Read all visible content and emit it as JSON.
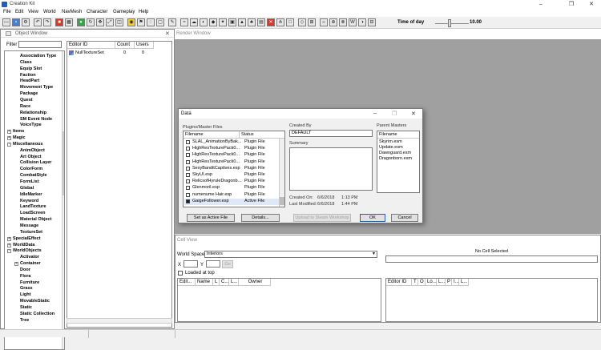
{
  "app": {
    "title": "Creation Kit"
  },
  "window_buttons": {
    "minimize": "–",
    "maximize": "❐",
    "close": "✕"
  },
  "menu": [
    "File",
    "Edit",
    "View",
    "World",
    "NavMesh",
    "Character",
    "Gameplay",
    "Help"
  ],
  "toolbar": {
    "time_of_day_label": "Time of day",
    "time_of_day_value": "10.00",
    "time_of_day_fraction": 0.42
  },
  "object_window": {
    "title": "Object Window",
    "filter_label": "Filter",
    "tree": [
      {
        "label": "Association Type",
        "indent": 1,
        "expander": ""
      },
      {
        "label": "Class",
        "indent": 1,
        "expander": ""
      },
      {
        "label": "Equip Slot",
        "indent": 1,
        "expander": ""
      },
      {
        "label": "Faction",
        "indent": 1,
        "expander": ""
      },
      {
        "label": "HeadPart",
        "indent": 1,
        "expander": ""
      },
      {
        "label": "Movement Type",
        "indent": 1,
        "expander": ""
      },
      {
        "label": "Package",
        "indent": 1,
        "expander": ""
      },
      {
        "label": "Quest",
        "indent": 1,
        "expander": ""
      },
      {
        "label": "Race",
        "indent": 1,
        "expander": ""
      },
      {
        "label": "Relationship",
        "indent": 1,
        "expander": ""
      },
      {
        "label": "SM Event Node",
        "indent": 1,
        "expander": ""
      },
      {
        "label": "VoiceType",
        "indent": 1,
        "expander": ""
      },
      {
        "label": "Items",
        "indent": 0,
        "expander": "+"
      },
      {
        "label": "Magic",
        "indent": 0,
        "expander": "+"
      },
      {
        "label": "Miscellaneous",
        "indent": 0,
        "expander": "-"
      },
      {
        "label": "AnimObject",
        "indent": 1,
        "expander": ""
      },
      {
        "label": "Art Object",
        "indent": 1,
        "expander": ""
      },
      {
        "label": "Collision Layer",
        "indent": 1,
        "expander": ""
      },
      {
        "label": "ColorForm",
        "indent": 1,
        "expander": ""
      },
      {
        "label": "CombatStyle",
        "indent": 1,
        "expander": ""
      },
      {
        "label": "FormList",
        "indent": 1,
        "expander": ""
      },
      {
        "label": "Global",
        "indent": 1,
        "expander": ""
      },
      {
        "label": "IdleMarker",
        "indent": 1,
        "expander": ""
      },
      {
        "label": "Keyword",
        "indent": 1,
        "expander": ""
      },
      {
        "label": "LandTexture",
        "indent": 1,
        "expander": ""
      },
      {
        "label": "LoadScreen",
        "indent": 1,
        "expander": ""
      },
      {
        "label": "Material Object",
        "indent": 1,
        "expander": ""
      },
      {
        "label": "Message",
        "indent": 1,
        "expander": ""
      },
      {
        "label": "TextureSet",
        "indent": 1,
        "expander": ""
      },
      {
        "label": "SpecialEffect",
        "indent": 0,
        "expander": "+"
      },
      {
        "label": "WorldData",
        "indent": 0,
        "expander": "+"
      },
      {
        "label": "WorldObjects",
        "indent": 0,
        "expander": "-"
      },
      {
        "label": "Activator",
        "indent": 1,
        "expander": ""
      },
      {
        "label": "Container",
        "indent": 1,
        "expander": "+"
      },
      {
        "label": "Door",
        "indent": 1,
        "expander": ""
      },
      {
        "label": "Flora",
        "indent": 1,
        "expander": ""
      },
      {
        "label": "Furniture",
        "indent": 1,
        "expander": ""
      },
      {
        "label": "Grass",
        "indent": 1,
        "expander": ""
      },
      {
        "label": "Light",
        "indent": 1,
        "expander": ""
      },
      {
        "label": "MovableStatic",
        "indent": 1,
        "expander": ""
      },
      {
        "label": "Static",
        "indent": 1,
        "expander": ""
      },
      {
        "label": "Static Collection",
        "indent": 1,
        "expander": ""
      },
      {
        "label": "Tree",
        "indent": 1,
        "expander": ""
      }
    ],
    "columns": [
      "Editor ID",
      "Count",
      "Users"
    ],
    "rows": [
      {
        "editor_id": "NullTextureSet",
        "count": "0",
        "users": "0"
      }
    ]
  },
  "render_window": {
    "title": "Render Window"
  },
  "cell_view": {
    "title": "Cell View",
    "world_space_label": "World Space",
    "world_space_value": "Interiors",
    "x_label": "X",
    "y_label": "Y",
    "go_label": "Go",
    "loaded_at_top_label": "Loaded at top",
    "no_cell_selected": "No Cell Selected",
    "left_columns": [
      "Edit...",
      "Name",
      "L",
      "C...",
      "L...",
      "Owner"
    ],
    "right_columns": [
      "Editor ID",
      "T",
      "O",
      "Lo...",
      "L...",
      "P",
      "I...",
      "L..."
    ]
  },
  "data_dialog": {
    "title": "Data",
    "plugins_label": "Plugins/Master Files",
    "col_filename": "Filename",
    "col_status": "Status",
    "files": [
      {
        "name": "SLAL_AnimationByBak...",
        "status": "Plugin File",
        "checked": false
      },
      {
        "name": "HighResTexturePack0...",
        "status": "Plugin File",
        "checked": false
      },
      {
        "name": "HighResTexturePack0...",
        "status": "Plugin File",
        "checked": false
      },
      {
        "name": "HighResTexturePack0...",
        "status": "Plugin File",
        "checked": false
      },
      {
        "name": "SexyBanditCaptives.esp",
        "status": "Plugin File",
        "checked": false
      },
      {
        "name": "SkyUI.esp",
        "status": "Plugin File",
        "checked": false
      },
      {
        "name": "RelicsofHyruleDragonb...",
        "status": "Plugin File",
        "checked": false
      },
      {
        "name": "Glenmoril.esp",
        "status": "Plugin File",
        "checked": false
      },
      {
        "name": "numenume Hair.esp",
        "status": "Plugin File",
        "checked": false
      },
      {
        "name": "GaigeFollower.esp",
        "status": "Active File",
        "checked": true
      }
    ],
    "created_by_label": "Created By",
    "created_by_value": "DEFAULT",
    "summary_label": "Summary",
    "created_on_label": "Created On:",
    "created_on_date": "6/6/2018",
    "created_on_time": "1:13 PM",
    "last_modified_label": "Last Modified:",
    "last_modified_date": "6/6/2018",
    "last_modified_time": "1:44 PM",
    "parent_masters_label": "Parent Masters",
    "parent_masters_col": "Filename",
    "parent_masters": [
      "Skyrim.esm",
      "Update.esm",
      "Dawnguard.esm",
      "Dragonborn.esm"
    ],
    "buttons": {
      "set_active": "Set as Active File",
      "details": "Details...",
      "upload": "Upload to Steam Workshop",
      "ok": "OK",
      "cancel": "Cancel"
    }
  },
  "colors": {
    "render_bg": "#a0a0a0",
    "panel_bg": "#f0f0f0",
    "accent": "#2a5caa"
  }
}
